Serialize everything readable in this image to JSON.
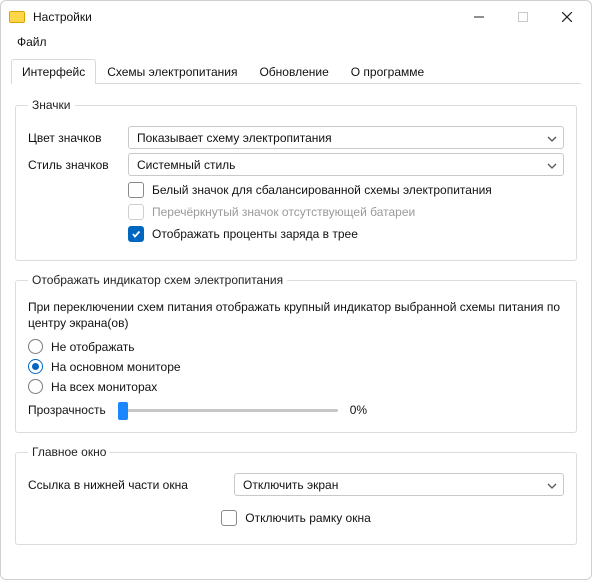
{
  "window": {
    "title": "Настройки"
  },
  "menu": {
    "file": "Файл"
  },
  "tabs": {
    "interface": "Интерфейс",
    "power_plans": "Схемы электропитания",
    "update": "Обновление",
    "about": "О программе",
    "active": "interface"
  },
  "icons_group": {
    "legend": "Значки",
    "color_label": "Цвет значков",
    "color_value": "Показывает схему электропитания",
    "style_label": "Стиль значков",
    "style_value": "Системный стиль",
    "white_icon": "Белый значок для сбалансированной схемы электропитания",
    "strike_missing": "Перечёркнутый значок отсутствующей батареи",
    "show_percent": "Отображать проценты заряда в трее"
  },
  "indicator_group": {
    "legend": "Отображать индикатор схем электропитания",
    "desc": "При переключении схем питания отображать крупный индикатор выбранной схемы питания по центру экрана(ов)",
    "opt_none": "Не отображать",
    "opt_primary": "На основном мониторе",
    "opt_all": "На всех мониторах",
    "selected": "primary",
    "opacity_label": "Прозрачность",
    "opacity_value": "0%"
  },
  "main_window_group": {
    "legend": "Главное окно",
    "bottom_link_label": "Ссылка в нижней части окна",
    "bottom_link_value": "Отключить экран",
    "disable_frame": "Отключить рамку окна"
  }
}
